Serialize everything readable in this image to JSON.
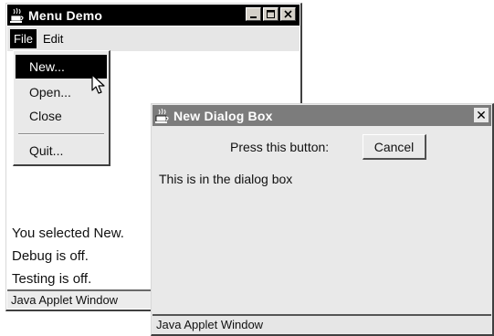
{
  "main_window": {
    "title": "Menu Demo",
    "menus": [
      "File",
      "Edit"
    ],
    "lines": [
      "You selected New.",
      "Debug is off.",
      "Testing is off."
    ],
    "status": "Java Applet Window"
  },
  "file_menu": {
    "items": [
      "New...",
      "Open...",
      "Close",
      "Quit..."
    ],
    "highlighted": "New..."
  },
  "dialog": {
    "title": "New Dialog Box",
    "prompt": "Press this button:",
    "button": "Cancel",
    "text": "This is in the dialog box",
    "close": "✕",
    "status": "Java Applet Window"
  },
  "icons": [
    "java-coffee-icon",
    "minimize-icon",
    "maximize-icon",
    "close-icon",
    "mouse-pointer-icon"
  ]
}
